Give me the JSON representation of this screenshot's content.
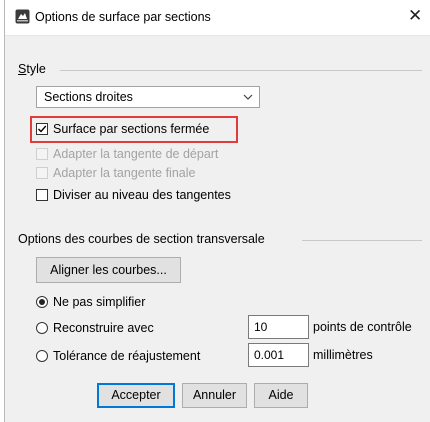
{
  "window": {
    "title": "Options de surface par sections",
    "close_glyph": "✕"
  },
  "style_group": {
    "label_first": "S",
    "label_rest": "tyle",
    "dropdown": {
      "selected": "Sections droites"
    },
    "checkboxes": [
      {
        "label": "Surface par sections fermée",
        "checked": true,
        "enabled": true
      },
      {
        "label": "Adapter la tangente de départ",
        "checked": false,
        "enabled": false
      },
      {
        "label": "Adapter la tangente finale",
        "checked": false,
        "enabled": false
      },
      {
        "label": "Diviser au niveau des tangentes",
        "checked": false,
        "enabled": true
      }
    ]
  },
  "curves_group": {
    "label": "Options des courbes de section transversale",
    "align_button": "Aligner les courbes...",
    "radios": [
      {
        "label": "Ne pas simplifier",
        "selected": true
      },
      {
        "label": "Reconstruire avec",
        "selected": false,
        "value": "10",
        "unit": "points de contrôle"
      },
      {
        "label": "Tolérance de réajustement",
        "selected": false,
        "value": "0.001",
        "unit": "millimètres"
      }
    ]
  },
  "buttons": {
    "accept": "Accepter",
    "cancel": "Annuler",
    "help": "Aide"
  },
  "icons": {
    "app": "rhino-icon",
    "dropdown": "chevron-down-icon",
    "check": "checkmark-icon"
  },
  "colors": {
    "highlight": "#e23b3b",
    "default_button_border": "#0078d7"
  }
}
